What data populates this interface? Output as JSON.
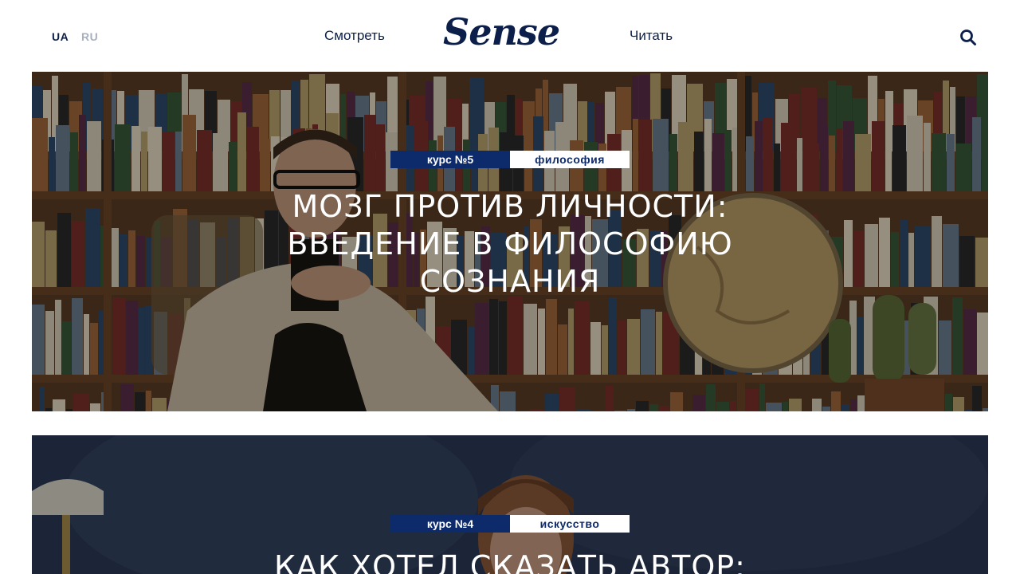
{
  "header": {
    "lang_ua": "UA",
    "lang_ru": "RU",
    "nav_watch": "Смотреть",
    "logo": "Sense",
    "nav_read": "Читать",
    "search_icon": "search-icon"
  },
  "colors": {
    "brand": "#0b1f4a",
    "tag_background": "#0d2a6b",
    "lang_inactive": "#a8afbd"
  },
  "cards": [
    {
      "course_number": "курс №5",
      "topic": "философия",
      "title": "Мозг против личности: введение в философию сознания"
    },
    {
      "course_number": "курс №4",
      "topic": "искусство",
      "title": "Как хотел сказать автор:"
    }
  ]
}
